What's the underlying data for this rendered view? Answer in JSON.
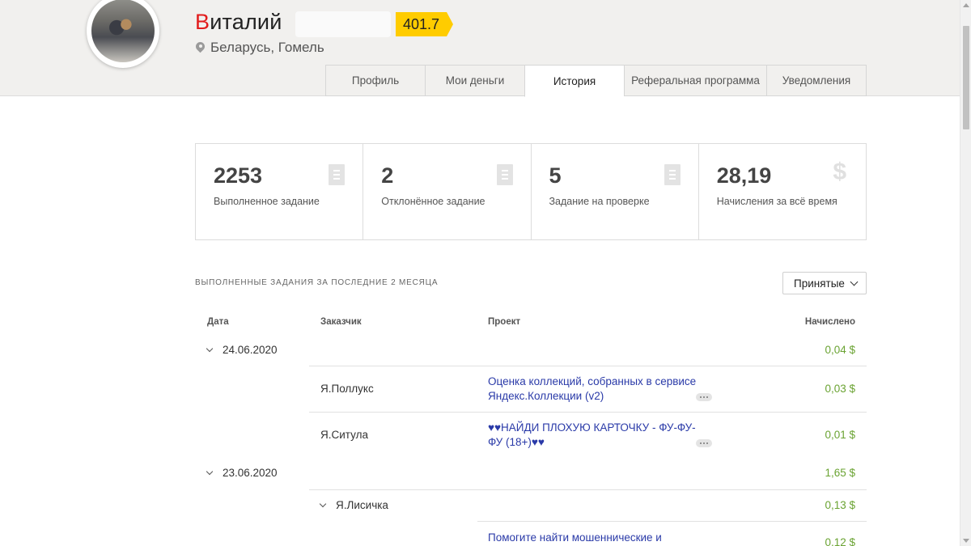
{
  "profile": {
    "name_first_letter": "В",
    "name_rest": "италий",
    "rating": "401.7",
    "location": "Беларусь, Гомель"
  },
  "tabs": [
    {
      "label": "Профиль",
      "active": false
    },
    {
      "label": "Мои деньги",
      "active": false
    },
    {
      "label": "История",
      "active": true
    },
    {
      "label": "Реферальная программа",
      "active": false
    },
    {
      "label": "Уведомления",
      "active": false
    }
  ],
  "stats": [
    {
      "value": "2253",
      "label": "Выполненное задание",
      "icon": "document-icon"
    },
    {
      "value": "2",
      "label": "Отклонённое задание",
      "icon": "document-icon"
    },
    {
      "value": "5",
      "label": "Задание на проверке",
      "icon": "document-icon"
    },
    {
      "value": "28,19",
      "label": "Начисления за всё время",
      "icon": "dollar-icon"
    }
  ],
  "section": {
    "title": "ВЫПОЛНЕННЫЕ ЗАДАНИЯ ЗА ПОСЛЕДНИЕ 2 МЕСЯЦА",
    "filter_value": "Принятые"
  },
  "table": {
    "headers": {
      "date": "Дата",
      "customer": "Заказчик",
      "project": "Проект",
      "amount": "Начислено"
    },
    "groups": [
      {
        "date": "24.06.2020",
        "total": "0,04 $",
        "rows": [
          {
            "customer": "Я.Поллукс",
            "project": "Оценка коллекций, собранных в сервисе Яндекс.Коллекции (v2)",
            "amount": "0,03 $"
          },
          {
            "customer": "Я.Ситула",
            "project": "♥♥НАЙДИ ПЛОХУЮ КАРТОЧКУ - ФУ-ФУ-ФУ (18+)♥♥",
            "amount": "0,01 $"
          }
        ]
      },
      {
        "date": "23.06.2020",
        "total": "1,65 $",
        "subgroups": [
          {
            "customer": "Я.Лисичка",
            "total": "0,13 $",
            "rows": [
              {
                "project": "Помогите найти мошеннические и",
                "amount": "0,12 $"
              }
            ]
          }
        ]
      }
    ]
  }
}
